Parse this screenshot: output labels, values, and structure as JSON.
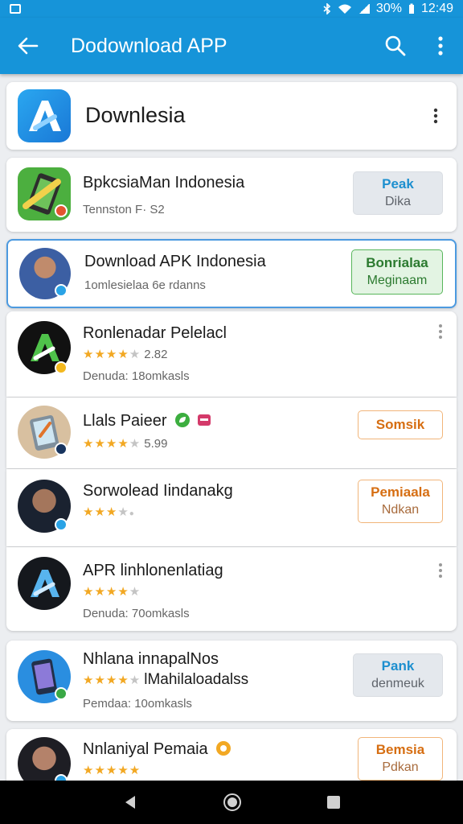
{
  "status_bar": {
    "battery": "30%",
    "time": "12:49"
  },
  "app_bar": {
    "title": "Dodownload APP",
    "back_icon": "arrow-left-icon",
    "search_icon": "search-icon",
    "menu_icon": "more-vert-icon"
  },
  "featured": {
    "name": "Downlesia"
  },
  "apps": [
    {
      "name": "BpkcsiaMan Indonesia",
      "subtitle": "Tennston F· S2",
      "button": {
        "line1": "Peak",
        "line2": "Dika"
      }
    },
    {
      "name": "Download APK Indonesia",
      "subtitle": "1omlesielaa 6e rdanns",
      "button": {
        "line1": "Bonrialaa",
        "line2": "Meginaam"
      }
    },
    {
      "name": "Ronlenadar Pelelacl",
      "rating_value": "2.82",
      "subtitle": "Denuda: 18omkasls"
    },
    {
      "name": "Llals Paieer",
      "rating_value": "5.99",
      "button": {
        "line1": "Somsik",
        "line2": ""
      }
    },
    {
      "name": "Sorwolead Iindanakg",
      "button": {
        "line1": "Pemiaala",
        "line2": "Ndkan"
      }
    },
    {
      "name": "APR linhlonenlatiag",
      "subtitle": "Denuda: 70omkasls"
    },
    {
      "name": "Nhlana innapalNos",
      "rating_value": "lMahilaloadalss",
      "subtitle": "Pemdaa: 10omkasls",
      "button": {
        "line1": "Pank",
        "line2": "denmeuk"
      }
    },
    {
      "name": "Nnlaniyal Pemaia",
      "button": {
        "line1": "Bemsia",
        "line2": "Pdkan"
      }
    }
  ],
  "colors": {
    "primary": "#1694d9",
    "star": "#f2a823",
    "install_green": "#58b65b",
    "install_orange": "#d66e12"
  }
}
